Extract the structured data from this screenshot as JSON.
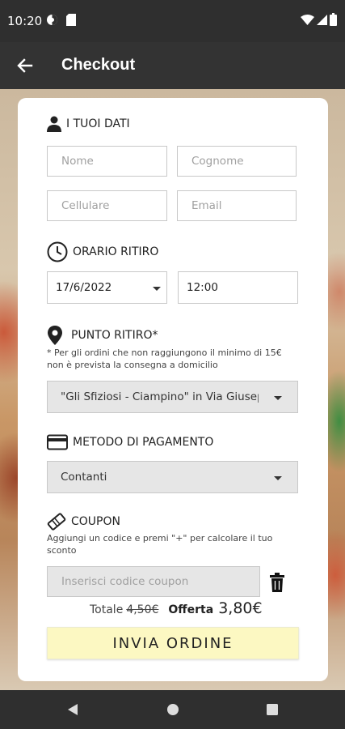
{
  "status_bar": {
    "time": "10:20"
  },
  "app_bar": {
    "title": "Checkout"
  },
  "dati": {
    "title": "I TUOI DATI",
    "nome_placeholder": "Nome",
    "cognome_placeholder": "Cognome",
    "cellulare_placeholder": "Cellulare",
    "email_placeholder": "Email"
  },
  "orario": {
    "title": "ORARIO RITIRO",
    "date": "17/6/2022",
    "time": "12:00"
  },
  "punto": {
    "title": "PUNTO RITIRO*",
    "note": "* Per gli ordini che non raggiungono il minimo di 15€ non è prevista la consegna a domicilio",
    "selected": "\"Gli Sfiziosi - Ciampino\" in Via Giuseppe"
  },
  "pagamento": {
    "title": "METODO DI PAGAMENTO",
    "selected": "Contanti"
  },
  "coupon": {
    "title": "COUPON",
    "note": "Aggiungi un codice e premi \"+\" per calcolare il tuo sconto",
    "placeholder": "Inserisci codice coupon"
  },
  "totals": {
    "totale_label": "Totale",
    "totale_old": "4,50€",
    "offerta_label": "Offerta",
    "offerta_value": "3,80€"
  },
  "submit_label": "INVIA ORDINE",
  "colors": {
    "button_bg": "#fcf8c2",
    "app_bar": "#333333"
  }
}
